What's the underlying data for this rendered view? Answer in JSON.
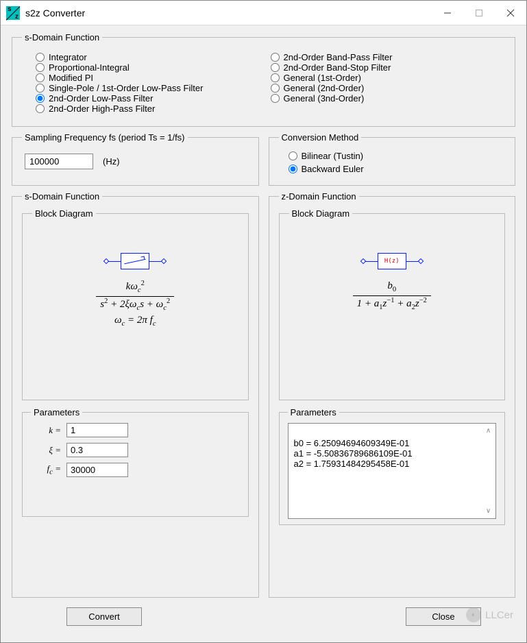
{
  "window": {
    "title": "s2z Converter"
  },
  "sdomain_group": {
    "legend": "s-Domain Function",
    "options_left": [
      {
        "label": "Integrator",
        "selected": false
      },
      {
        "label": "Proportional-Integral",
        "selected": false
      },
      {
        "label": "Modified PI",
        "selected": false
      },
      {
        "label": "Single-Pole / 1st-Order Low-Pass Filter",
        "selected": false
      },
      {
        "label": "2nd-Order Low-Pass Filter",
        "selected": true
      },
      {
        "label": "2nd-Order High-Pass Filter",
        "selected": false
      }
    ],
    "options_right": [
      {
        "label": "2nd-Order Band-Pass Filter",
        "selected": false
      },
      {
        "label": "2nd-Order Band-Stop Filter",
        "selected": false
      },
      {
        "label": "General (1st-Order)",
        "selected": false
      },
      {
        "label": "General (2nd-Order)",
        "selected": false
      },
      {
        "label": "General (3nd-Order)",
        "selected": false
      }
    ]
  },
  "sampling": {
    "legend": "Sampling Frequency fs (period Ts = 1/fs)",
    "value": "100000",
    "unit": "(Hz)"
  },
  "conversion": {
    "legend": "Conversion Method",
    "options": [
      {
        "label": "Bilinear (Tustin)",
        "selected": false
      },
      {
        "label": "Backward Euler",
        "selected": true
      }
    ]
  },
  "s_func": {
    "legend": "s-Domain Function",
    "block_legend": "Block Diagram",
    "params_legend": "Parameters",
    "params": {
      "k_label": "k =",
      "k_value": "1",
      "xi_label": "ξ =",
      "xi_value": "0.3",
      "fc_label": "fₑ =",
      "fc_value": "30000"
    }
  },
  "z_func": {
    "legend": "z-Domain Function",
    "block_legend": "Block Diagram",
    "box_text": "H(z)",
    "params_legend": "Parameters",
    "params_text": "b0 = 6.25094694609349E-01\na1 = -5.50836789686109E-01\na2 = 1.75931484295458E-01"
  },
  "buttons": {
    "convert": "Convert",
    "close": "Close"
  },
  "watermark": "LLCer"
}
